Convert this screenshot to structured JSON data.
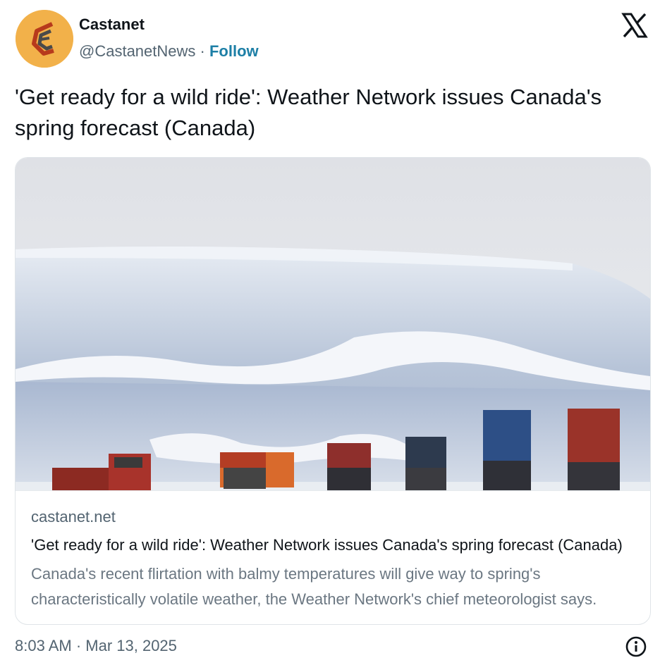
{
  "author": {
    "name": "Castanet",
    "handle": "@CastanetNews",
    "separator": " · ",
    "follow_label": "Follow",
    "avatar_icon": "castanet-logo-icon"
  },
  "header": {
    "platform_icon": "x-logo-icon"
  },
  "tweet": {
    "text": "'Get ready for a wild ride': Weather Network issues Canada's spring forecast (Canada)"
  },
  "card": {
    "image_icon": "snow-pile-trucks-photo",
    "domain": "castanet.net",
    "title": "'Get ready for a wild ride': Weather Network issues Canada's spring forecast (Canada)",
    "description": "Canada's recent flirtation with balmy temperatures will give way to spring's characteristically volatile weather, the Weather Network's chief meteorologist says."
  },
  "footer": {
    "timestamp": "8:03 AM · Mar 13, 2025",
    "info_icon": "info-icon"
  },
  "colors": {
    "follow": "#1d7fa6",
    "avatar_bg": "#f2b14a",
    "secondary_text": "#536471"
  }
}
